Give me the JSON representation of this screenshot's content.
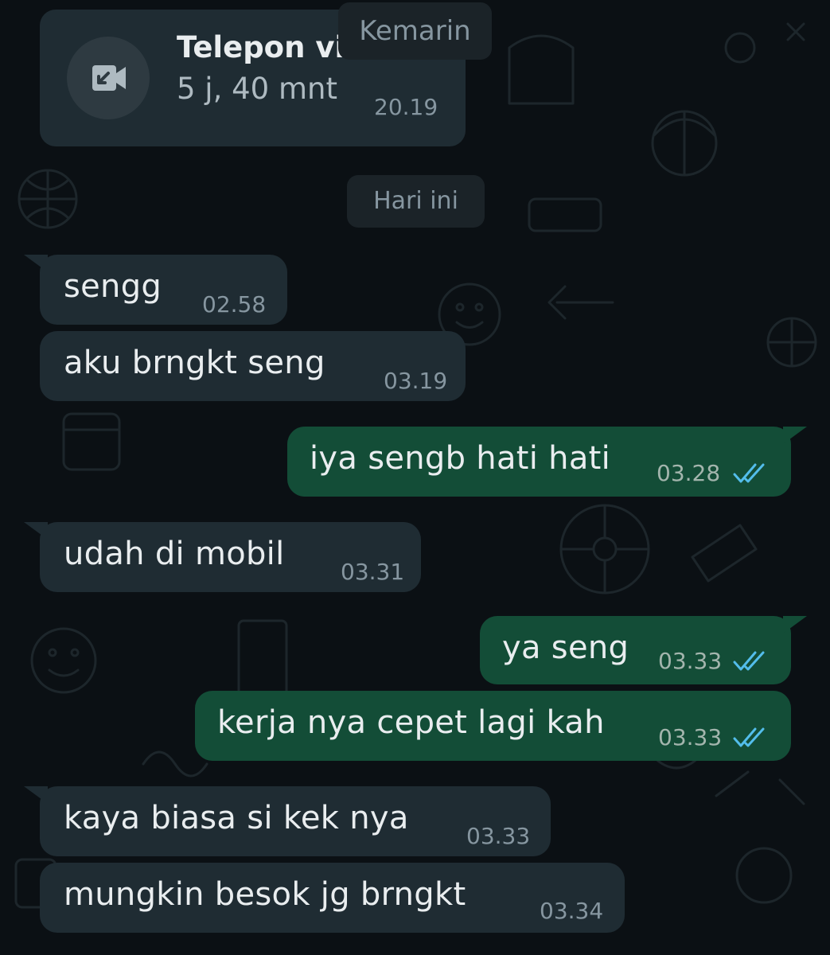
{
  "colors": {
    "background": "#0b1014",
    "incoming_bubble": "#1f2c33",
    "outgoing_bubble": "#134d37",
    "text": "#e9edef",
    "timestamp": "#8696a0",
    "read_ticks": "#53bdeb"
  },
  "call": {
    "title": "Telepon vi",
    "duration": "5 j, 40 mnt",
    "time": "20.19",
    "icon": "missed-video-call-icon"
  },
  "date_chips": {
    "yesterday": "Kemarin",
    "today": "Hari ini"
  },
  "messages": [
    {
      "direction": "in",
      "text": "sengg",
      "time": "02.58"
    },
    {
      "direction": "in",
      "text": "aku brngkt seng",
      "time": "03.19"
    },
    {
      "direction": "out",
      "text": "iya sengb hati hati",
      "time": "03.28",
      "status": "read"
    },
    {
      "direction": "in",
      "text": "udah di mobil",
      "time": "03.31"
    },
    {
      "direction": "out",
      "text": "ya seng",
      "time": "03.33",
      "status": "read"
    },
    {
      "direction": "out",
      "text": "kerja nya cepet lagi kah",
      "time": "03.33",
      "status": "read"
    },
    {
      "direction": "in",
      "text": "kaya biasa si kek nya",
      "time": "03.33"
    },
    {
      "direction": "in",
      "text": "mungkin besok jg brngkt",
      "time": "03.34"
    }
  ]
}
